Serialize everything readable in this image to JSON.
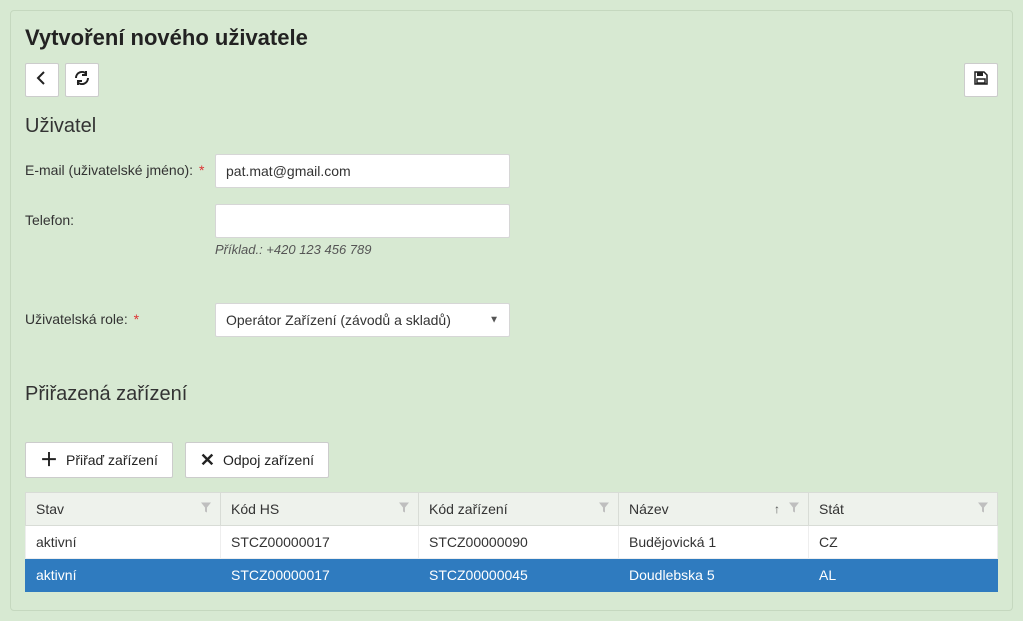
{
  "page": {
    "title": "Vytvoření nového uživatele"
  },
  "sections": {
    "user": "Uživatel",
    "devices": "Přiřazená zařízení"
  },
  "form": {
    "email_label": "E-mail (uživatelské jméno):",
    "email_value": "pat.mat@gmail.com",
    "phone_label": "Telefon:",
    "phone_value": "",
    "phone_hint": "Příklad.: +420 123 456 789",
    "role_label": "Uživatelská role:",
    "role_value": "Operátor Zařízení (závodů a skladů)"
  },
  "buttons": {
    "assign": "Přiřaď zařízení",
    "unassign": "Odpoj zařízení"
  },
  "table": {
    "headers": {
      "stav": "Stav",
      "kod_hs": "Kód HS",
      "kod_zarizeni": "Kód zařízení",
      "nazev": "Název",
      "stat": "Stát"
    },
    "rows": [
      {
        "stav": "aktivní",
        "kod_hs": "STCZ00000017",
        "kod_zarizeni": "STCZ00000090",
        "nazev": "Budějovická 1",
        "stat": "CZ",
        "selected": false
      },
      {
        "stav": "aktivní",
        "kod_hs": "STCZ00000017",
        "kod_zarizeni": "STCZ00000045",
        "nazev": "Doudlebska 5",
        "stat": "AL",
        "selected": true
      }
    ]
  }
}
